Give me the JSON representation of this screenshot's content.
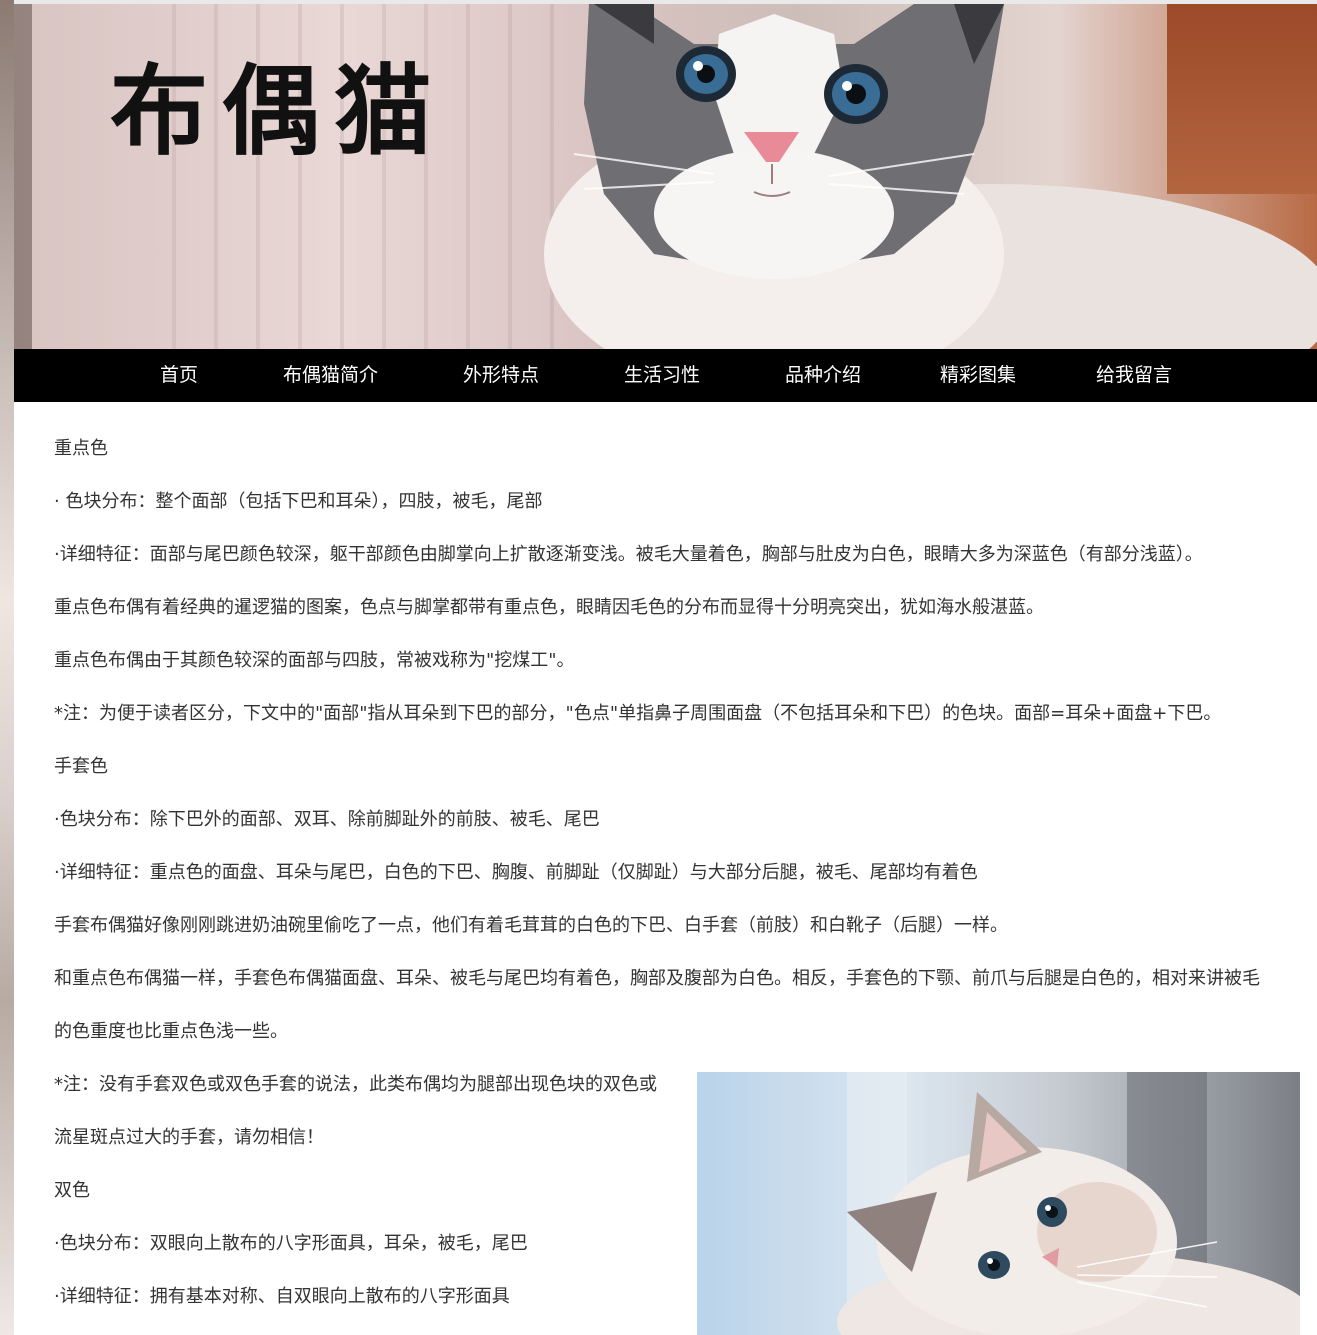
{
  "header": {
    "site_title": "布偶猫"
  },
  "nav": {
    "items": [
      {
        "label": "首页"
      },
      {
        "label": "布偶猫简介"
      },
      {
        "label": "外形特点"
      },
      {
        "label": "生活习性"
      },
      {
        "label": "品种介绍"
      },
      {
        "label": "精彩图集"
      },
      {
        "label": "给我留言"
      }
    ]
  },
  "content": {
    "lines": [
      "重点色",
      "· 色块分布：整个面部（包括下巴和耳朵），四肢，被毛，尾部",
      "·详细特征：面部与尾巴颜色较深，躯干部颜色由脚掌向上扩散逐渐变浅。被毛大量着色，胸部与肚皮为白色，眼睛大多为深蓝色（有部分浅蓝）。",
      "重点色布偶有着经典的暹逻猫的图案，色点与脚掌都带有重点色，眼睛因毛色的分布而显得十分明亮突出，犹如海水般湛蓝。",
      "重点色布偶由于其颜色较深的面部与四肢，常被戏称为\"挖煤工\"。",
      "*注：为便于读者区分，下文中的\"面部\"指从耳朵到下巴的部分，\"色点\"单指鼻子周围面盘（不包括耳朵和下巴）的色块。面部=耳朵+面盘+下巴。",
      "手套色",
      "·色块分布：除下巴外的面部、双耳、除前脚趾外的前肢、被毛、尾巴",
      "·详细特征：重点色的面盘、耳朵与尾巴，白色的下巴、胸腹、前脚趾（仅脚趾）与大部分后腿，被毛、尾部均有着色",
      "手套布偶猫好像刚刚跳进奶油碗里偷吃了一点，他们有着毛茸茸的白色的下巴、白手套（前肢）和白靴子（后腿）一样。",
      "和重点色布偶猫一样，手套色布偶猫面盘、耳朵、被毛与尾巴均有着色，胸部及腹部为白色。相反，手套色的下颚、前爪与后腿是白色的，相对来讲被毛",
      "的色重度也比重点色浅一些。",
      "*注：没有手套双色或双色手套的说法，此类布偶均为腿部出现色块的双色或",
      "流星斑点过大的手套，请勿相信！",
      "双色",
      "·色块分布：双眼向上散布的八字形面具，耳朵，被毛，尾巴",
      "·详细特征：拥有基本对称、自双眼向上散布的八字形面具"
    ]
  }
}
